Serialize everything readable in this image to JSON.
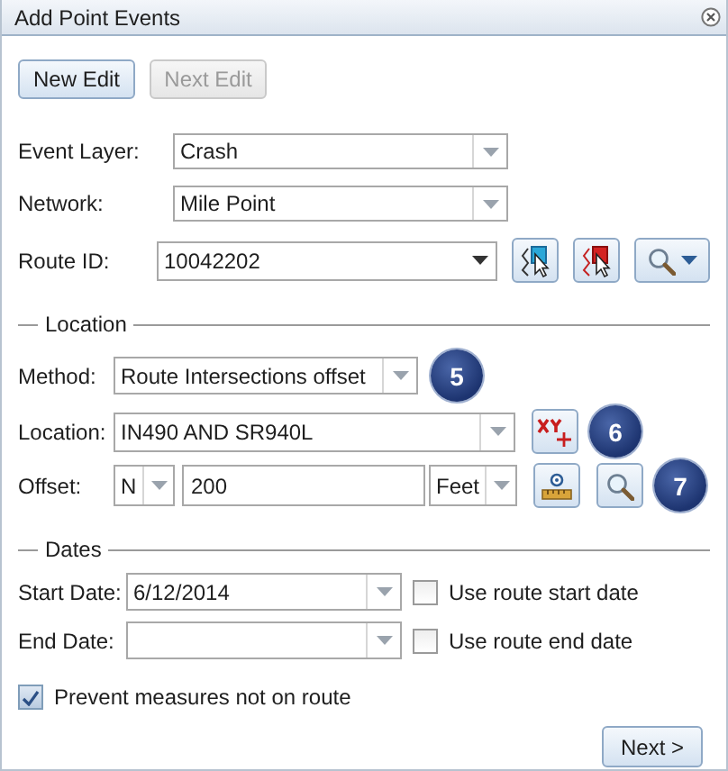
{
  "window": {
    "title": "Add Point Events"
  },
  "toolbar": [
    {
      "label": "New Edit",
      "disabled": false
    },
    {
      "label": "Next Edit",
      "disabled": true
    }
  ],
  "event_layer": {
    "label": "Event Layer:",
    "value": "Crash"
  },
  "network": {
    "label": "Network:",
    "value": "Mile Point"
  },
  "route_id": {
    "label": "Route ID:",
    "value": "10042202"
  },
  "location_section": {
    "legend": "Location",
    "method": {
      "label": "Method:",
      "value": "Route Intersections offset",
      "badge": "5"
    },
    "location": {
      "label": "Location:",
      "value": "IN490 AND SR940L",
      "badge": "6"
    },
    "offset": {
      "label": "Offset:",
      "direction": "N",
      "distance": "200",
      "units": "Feet",
      "badge": "7"
    }
  },
  "dates_section": {
    "legend": "Dates",
    "start_date": {
      "label": "Start Date:",
      "value": "6/12/2014",
      "checkbox_label": "Use route start date",
      "checked": false
    },
    "end_date": {
      "label": "End Date:",
      "checkbox_label": "Use route end date",
      "checked": false
    }
  },
  "prevent_measures": {
    "label": "Prevent measures not on route",
    "checked": true
  },
  "next_button": "Next >"
}
